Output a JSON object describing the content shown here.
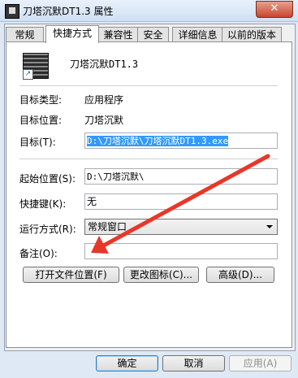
{
  "window": {
    "title": "刀塔沉默DT1.3 属性",
    "close_label": "✕"
  },
  "tabs": [
    "常规",
    "快捷方式",
    "兼容性",
    "安全",
    "详细信息",
    "以前的版本"
  ],
  "active_tab": "快捷方式",
  "header": {
    "name": "刀塔沉默DT1.3"
  },
  "fields": {
    "target_type_label": "目标类型:",
    "target_type_value": "应用程序",
    "target_location_label": "目标位置:",
    "target_location_value": "刀塔沉默",
    "target_label": "目标(T):",
    "target_value": "D:\\刀塔沉默\\刀塔沉默DT1.3.exe",
    "start_in_label": "起始位置(S):",
    "start_in_value": "D:\\刀塔沉默\\",
    "shortcut_key_label": "快捷键(K):",
    "shortcut_key_value": "无",
    "run_label": "运行方式(R):",
    "run_value": "常规窗口",
    "comment_label": "备注(O):",
    "comment_value": ""
  },
  "buttons": {
    "open_location": "打开文件位置(F)",
    "change_icon": "更改图标(C)...",
    "advanced": "高级(D)...",
    "ok": "确定",
    "cancel": "取消",
    "apply": "应用(A)"
  },
  "colors": {
    "selection": "#3399ff",
    "annotation_arrow": "#e8372a"
  },
  "icons": {
    "app": "app-icon",
    "shortcut_overlay": "shortcut-arrow-icon"
  }
}
